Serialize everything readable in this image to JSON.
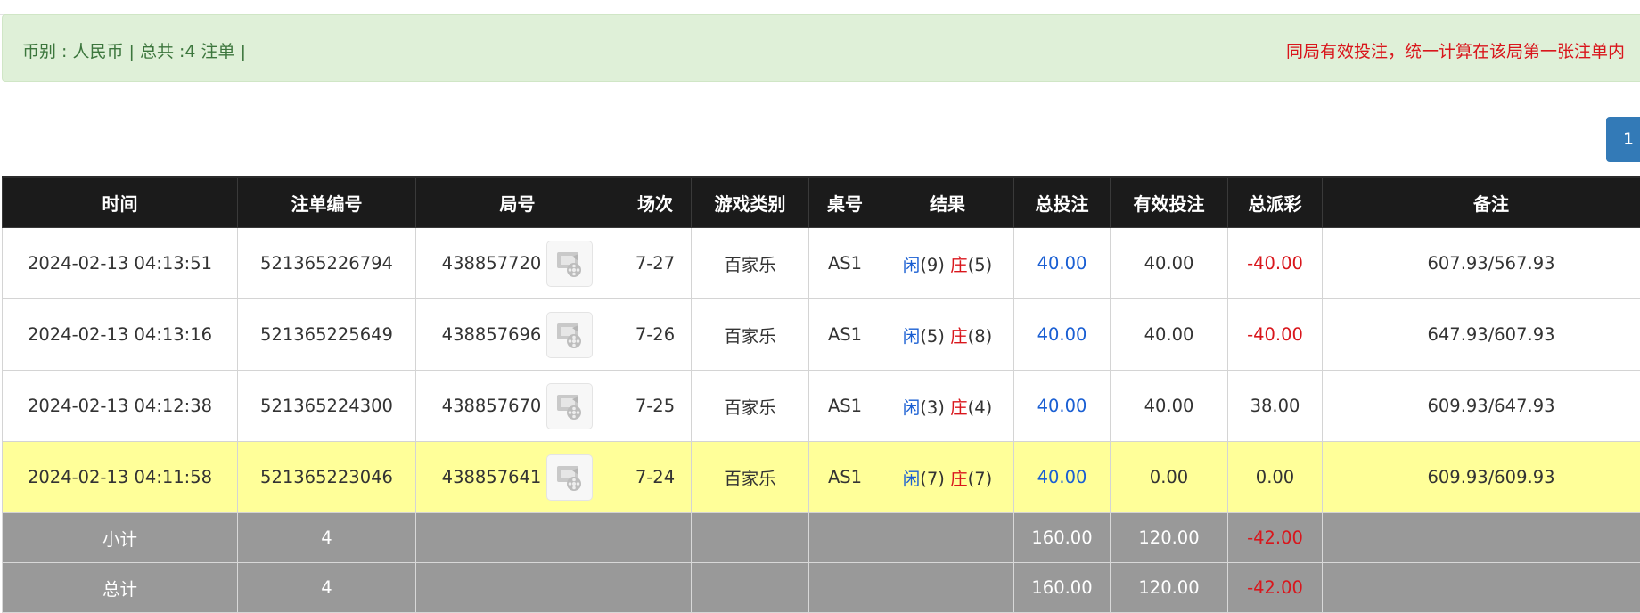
{
  "summary": {
    "left": "币别 : 人民币 | 总共 :4 注单 |",
    "right": "同局有效投注，统一计算在该局第一张注单内"
  },
  "pagination": {
    "current": "1"
  },
  "table": {
    "headers": [
      "时间",
      "注单编号",
      "局号",
      "场次",
      "游戏类别",
      "桌号",
      "结果",
      "总投注",
      "有效投注",
      "总派彩",
      "备注"
    ],
    "rows": [
      {
        "time": "2024-02-13 04:13:51",
        "bet_id": "521365226794",
        "round": "438857720",
        "session": "7-27",
        "game": "百家乐",
        "table": "AS1",
        "player_label": "闲",
        "player_val": "(9)",
        "banker_label": "庄",
        "banker_val": "(5)",
        "total_bet": "40.00",
        "valid_bet": "40.00",
        "payout": "-40.00",
        "payout_negative": true,
        "note": "607.93/567.93",
        "highlight": false
      },
      {
        "time": "2024-02-13 04:13:16",
        "bet_id": "521365225649",
        "round": "438857696",
        "session": "7-26",
        "game": "百家乐",
        "table": "AS1",
        "player_label": "闲",
        "player_val": "(5)",
        "banker_label": "庄",
        "banker_val": "(8)",
        "total_bet": "40.00",
        "valid_bet": "40.00",
        "payout": "-40.00",
        "payout_negative": true,
        "note": "647.93/607.93",
        "highlight": false
      },
      {
        "time": "2024-02-13 04:12:38",
        "bet_id": "521365224300",
        "round": "438857670",
        "session": "7-25",
        "game": "百家乐",
        "table": "AS1",
        "player_label": "闲",
        "player_val": "(3)",
        "banker_label": "庄",
        "banker_val": "(4)",
        "total_bet": "40.00",
        "valid_bet": "40.00",
        "payout": "38.00",
        "payout_negative": false,
        "note": "609.93/647.93",
        "highlight": false
      },
      {
        "time": "2024-02-13 04:11:58",
        "bet_id": "521365223046",
        "round": "438857641",
        "session": "7-24",
        "game": "百家乐",
        "table": "AS1",
        "player_label": "闲",
        "player_val": "(7)",
        "banker_label": "庄",
        "banker_val": "(7)",
        "total_bet": "40.00",
        "valid_bet": "0.00",
        "payout": "0.00",
        "payout_negative": false,
        "note": "609.93/609.93",
        "highlight": true
      }
    ],
    "subtotal": {
      "label": "小计",
      "count": "4",
      "total_bet": "160.00",
      "valid_bet": "120.00",
      "payout": "-42.00"
    },
    "grandtotal": {
      "label": "总计",
      "count": "4",
      "total_bet": "160.00",
      "valid_bet": "120.00",
      "payout": "-42.00"
    }
  },
  "colors": {
    "header_bg": "#1b1b1b",
    "alert_bg": "#dff0d8",
    "highlight_row": "#ffff99",
    "summary_row": "#999999",
    "negative": "#d9161c",
    "bet_blue": "#1a5fd3",
    "pager": "#337ab7"
  },
  "icons": {
    "video": "video-replay-icon"
  }
}
